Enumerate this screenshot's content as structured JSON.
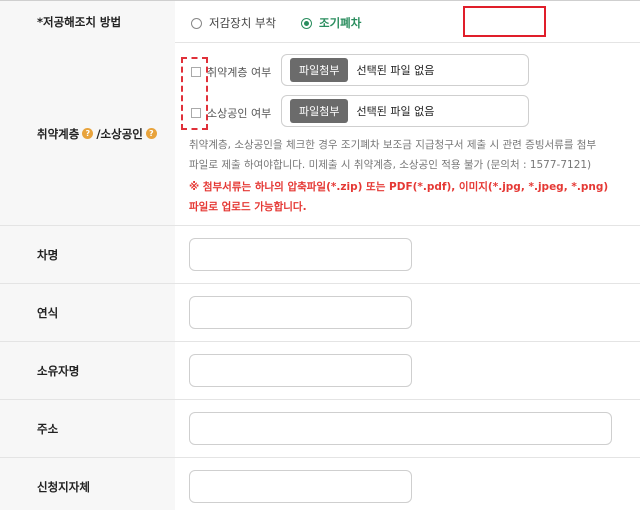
{
  "method": {
    "label": "*저공해조치 방법",
    "options": [
      {
        "label": "저감장치 부착",
        "selected": false
      },
      {
        "label": "조기폐차",
        "selected": true
      }
    ]
  },
  "vulnerable": {
    "label_part1": "취약계층",
    "label_part2": "/소상공인",
    "help_glyph": "?",
    "items": [
      {
        "label": "취약계층 여부",
        "button": "파일첨부",
        "file_status": "선택된 파일 없음"
      },
      {
        "label": "소상공인 여부",
        "button": "파일첨부",
        "file_status": "선택된 파일 없음"
      }
    ],
    "notice": "취약계층, 소상공인을 체크한 경우 조기폐차 보조금 지급청구서 제출 시 관련 증빙서류를 첨부 파일로 제출 하여야합니다. 미제출 시 취약계층, 소상공인 적용 불가 (문의처 : 1577-7121)",
    "warning": "※ 첨부서류는 하나의 압축파일(*.zip) 또는 PDF(*.pdf), 이미지(*.jpg, *.jpeg, *.png) 파일로 업로드 가능합니다."
  },
  "fields": [
    {
      "label": "차명",
      "value": ""
    },
    {
      "label": "연식",
      "value": ""
    },
    {
      "label": "소유자명",
      "value": ""
    },
    {
      "label": "주소",
      "value": ""
    },
    {
      "label": "신청지자체",
      "value": ""
    }
  ],
  "colors": {
    "accent_green": "#2a8d5e",
    "warning_red": "#e53935",
    "highlight_red": "#e01e2a",
    "help_orange": "#e8a33c"
  }
}
